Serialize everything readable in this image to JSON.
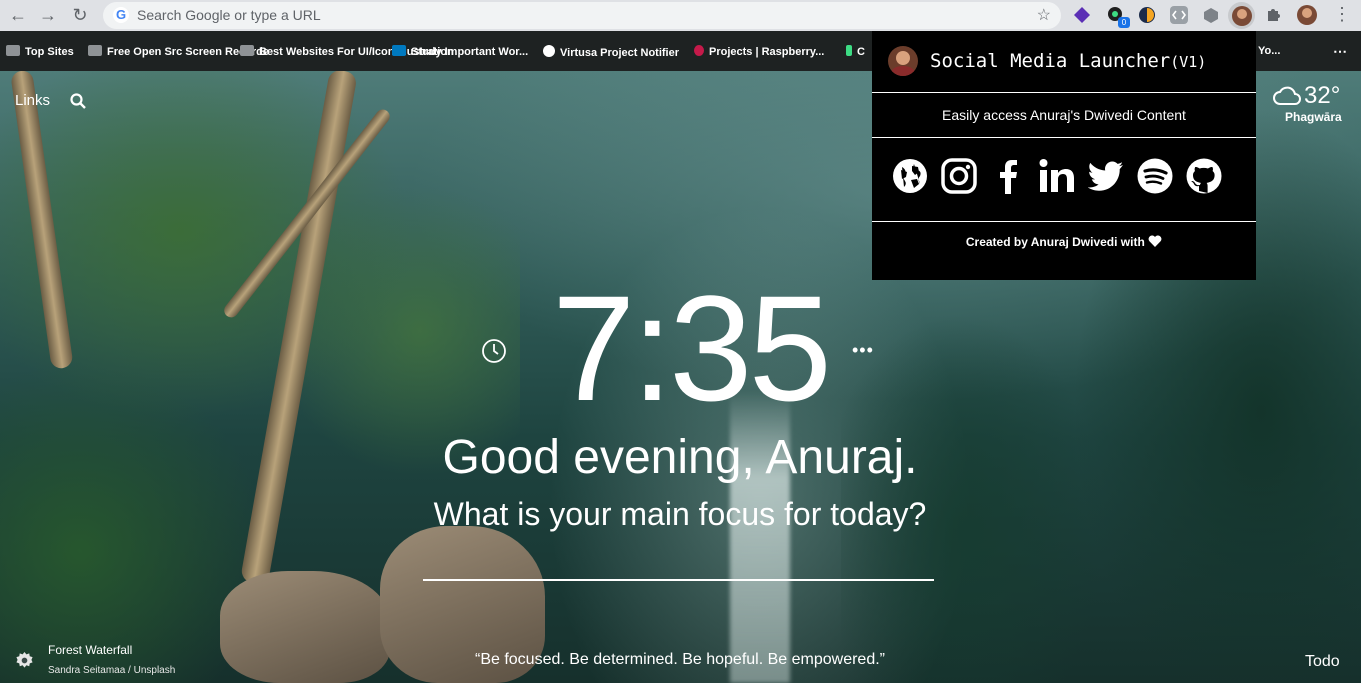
{
  "browser": {
    "omnibox_placeholder": "Search Google or type a URL",
    "google_letter": "G"
  },
  "bookmarks": [
    {
      "label": "Top Sites",
      "icon": "folder-icon"
    },
    {
      "label": "Free Open Src Screen Recorder",
      "icon": "folder-icon"
    },
    {
      "label": "Best Websites For UI/Icon Illustrations",
      "icon": "folder-icon"
    },
    {
      "label": "Study Important Wor...",
      "icon": "trello-icon"
    },
    {
      "label": "Virtusa Project Notifier",
      "icon": "github-icon"
    },
    {
      "label": "Projects | Raspberry...",
      "icon": "raspberry-icon"
    },
    {
      "label": "C",
      "icon": "site-icon"
    },
    {
      "label": "Yo...",
      "icon": "site-icon"
    }
  ],
  "extension_badge": "0",
  "dashboard": {
    "links_label": "Links",
    "weather": {
      "temp": "32°",
      "city": "Phagwāra"
    },
    "time": "7:35",
    "greeting": "Good evening, Anuraj.",
    "focus_prompt": "What is your main focus for today?",
    "photo": {
      "title": "Forest Waterfall",
      "credit": "Sandra Seitamaa / Unsplash"
    },
    "quote": "“Be focused. Be determined. Be hopeful. Be empowered.”",
    "todo_label": "Todo"
  },
  "popup": {
    "title": "Social Media Launcher",
    "version": "(V1)",
    "subtitle": "Easily access Anuraj's Dwivedi Content",
    "social": [
      "globe-icon",
      "instagram-icon",
      "facebook-icon",
      "linkedin-icon",
      "twitter-icon",
      "spotify-icon",
      "github-icon"
    ],
    "footer": "Created by Anuraj Dwivedi with"
  },
  "colors": {
    "popup_bg": "#000000",
    "toolbar_bg": "#dfe1e5",
    "bookmarks_bg": "#1e2222"
  }
}
